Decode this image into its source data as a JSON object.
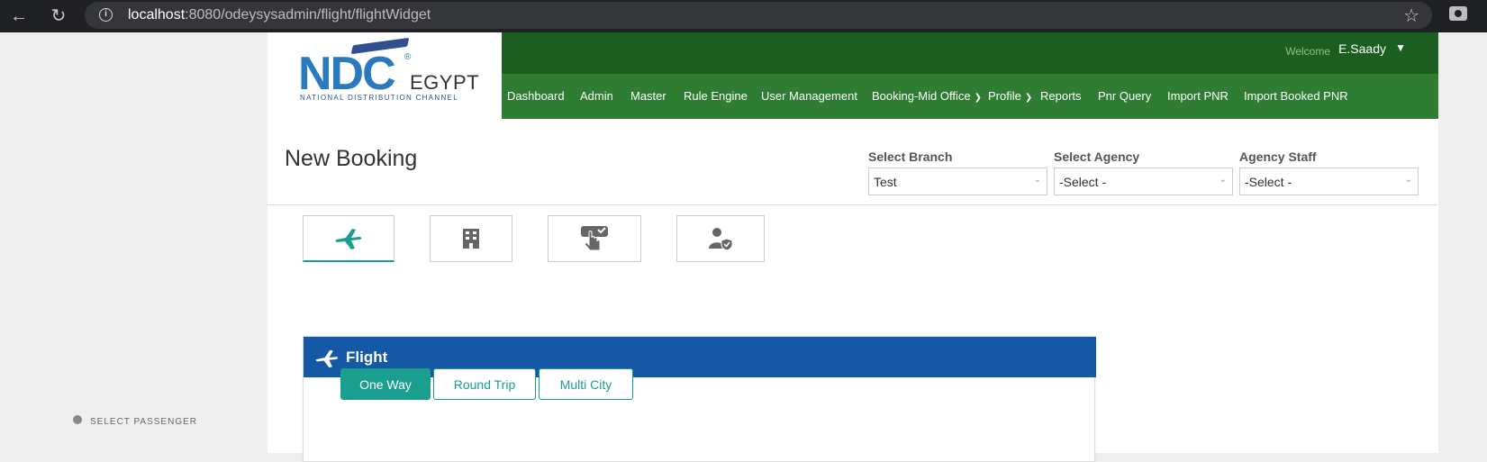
{
  "browser": {
    "url_host": "localhost",
    "url_rest": ":8080/odeysysadmin/flight/flightWidget"
  },
  "logo": {
    "brand": "NDC",
    "reg": "®",
    "country": "EGYPT",
    "tagline": "NATIONAL DISTRIBUTION CHANNEL"
  },
  "header": {
    "welcome": "Welcome",
    "user": "E.Saady"
  },
  "nav": {
    "items": [
      {
        "label": "Dashboard"
      },
      {
        "label": "Admin"
      },
      {
        "label": "Master"
      },
      {
        "label": "Rule Engine"
      },
      {
        "label": "User Management"
      },
      {
        "label": "Booking-Mid Office"
      },
      {
        "label": "Profile"
      },
      {
        "label": "Reports"
      },
      {
        "label": "Pnr Query"
      },
      {
        "label": "Import PNR"
      },
      {
        "label": "Import Booked PNR"
      }
    ]
  },
  "page": {
    "title": "New Booking"
  },
  "filters": {
    "branch": {
      "label": "Select Branch",
      "value": "Test"
    },
    "agency": {
      "label": "Select Agency",
      "value": "-Select -"
    },
    "staff": {
      "label": "Agency Staff",
      "value": "-Select -"
    }
  },
  "tabs": [
    {
      "icon": "airplane-icon",
      "active": true
    },
    {
      "icon": "hotel-building-icon",
      "active": false
    },
    {
      "icon": "hand-select-icon",
      "active": false
    },
    {
      "icon": "user-shield-icon",
      "active": false
    }
  ],
  "flight": {
    "title": "Flight",
    "trip_types": [
      "One Way",
      "Round Trip",
      "Multi City"
    ],
    "selected_trip": "One Way",
    "pax_label": "SELECT PASSENGER"
  },
  "colors": {
    "topbar": "#1b5e20",
    "navbar": "#2e7d32",
    "flight_header": "#1558a6",
    "accent": "#1a9e8f"
  }
}
